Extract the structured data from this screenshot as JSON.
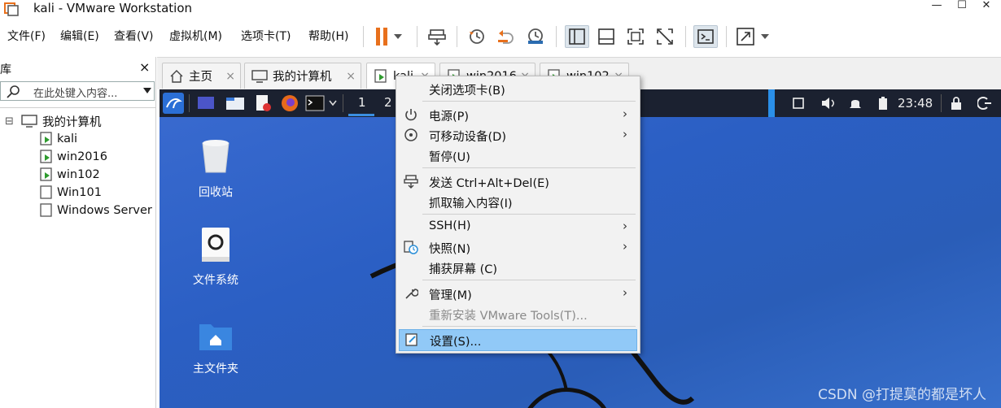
{
  "window": {
    "title": "kali - VMware Workstation",
    "minimize": "—",
    "maximize": "☐",
    "close": "✕"
  },
  "menubar": {
    "items": [
      "文件(F)",
      "编辑(E)",
      "查看(V)",
      "虚拟机(M)",
      "选项卡(T)",
      "帮助(H)"
    ]
  },
  "library": {
    "title": "库",
    "close": "×",
    "search_placeholder": "在此处键入内容...",
    "tree": {
      "root": "我的计算机",
      "collapse_glyph": "⊟",
      "vms": [
        "kali",
        "win2016",
        "win102",
        "Win101",
        "Windows Server"
      ]
    }
  },
  "tabs": [
    {
      "label": "主页"
    },
    {
      "label": "我的计算机"
    },
    {
      "label": "kali"
    },
    {
      "label": "win2016"
    },
    {
      "label": "win102"
    }
  ],
  "tab_close": "×",
  "vm": {
    "workspaces": [
      "1",
      "2"
    ],
    "clock": "23:48",
    "desktop_icons": [
      "回收站",
      "文件系统",
      "主文件夹"
    ]
  },
  "context_menu": {
    "items": [
      {
        "label": "关闭选项卡(B)",
        "icon": "",
        "submenu": false
      },
      {
        "label": "电源(P)",
        "icon": "power-icon",
        "submenu": true
      },
      {
        "label": "可移动设备(D)",
        "icon": "removable-device-icon",
        "submenu": true
      },
      {
        "label": "暂停(U)",
        "icon": "",
        "submenu": false
      },
      {
        "label": "发送 Ctrl+Alt+Del(E)",
        "icon": "send-keys-icon",
        "submenu": false
      },
      {
        "label": "抓取输入内容(I)",
        "icon": "",
        "submenu": false
      },
      {
        "label": "SSH(H)",
        "icon": "",
        "submenu": true
      },
      {
        "label": "快照(N)",
        "icon": "snapshot-icon",
        "submenu": true
      },
      {
        "label": "捕获屏幕 (C)",
        "icon": "",
        "submenu": false
      },
      {
        "label": "管理(M)",
        "icon": "wrench-icon",
        "submenu": true
      },
      {
        "label": "重新安装 VMware Tools(T)...",
        "icon": "",
        "submenu": false,
        "disabled": true
      },
      {
        "label": "设置(S)...",
        "icon": "settings-icon",
        "submenu": false,
        "highlighted": true
      }
    ],
    "submenu_arrow": "›"
  },
  "watermark": "CSDN @打提莫的都是坏人",
  "colors": {
    "pause_orange": "#e8701c",
    "menu_highlight": "#91c9f7",
    "vm_bg": "#2b5fc4",
    "kali_panel": "#1b2130"
  }
}
